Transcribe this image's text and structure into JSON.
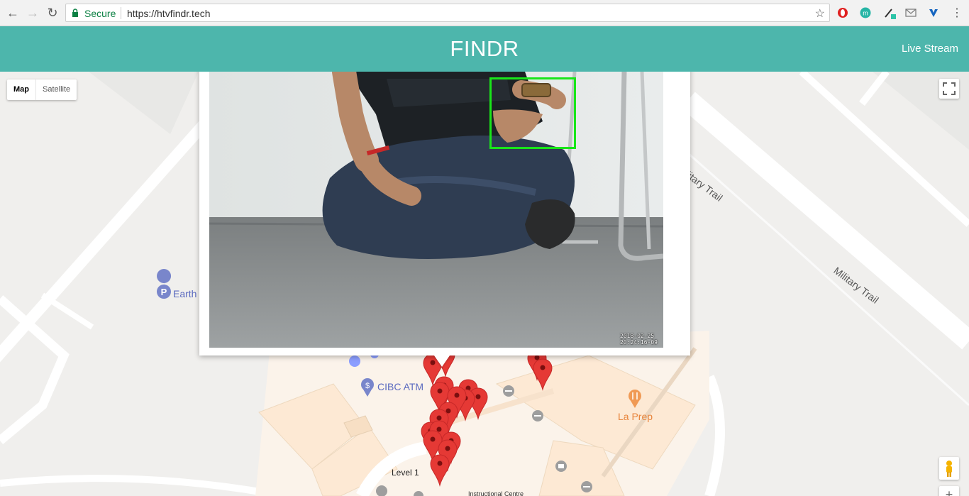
{
  "browser": {
    "secure_label": "Secure",
    "url": "https://htvfindr.tech"
  },
  "header": {
    "title": "FINDR",
    "live_stream": "Live Stream"
  },
  "map": {
    "type_control": {
      "map": "Map",
      "satellite": "Satellite"
    },
    "labels": {
      "military_trail_1": "Military Trail",
      "military_trail_2": "Military Trail",
      "earth": "Earth",
      "cibc": "CIBC ATM",
      "la_prep": "La Prep",
      "level": "Level 1",
      "instructional": "Instructional Centre"
    },
    "marker_color": "#e53935",
    "zoom_in": "+"
  },
  "camera": {
    "timestamp_date": "2018-02-25",
    "timestamp_time": "20:24:16-09",
    "detection_box_color": "#19e619"
  }
}
